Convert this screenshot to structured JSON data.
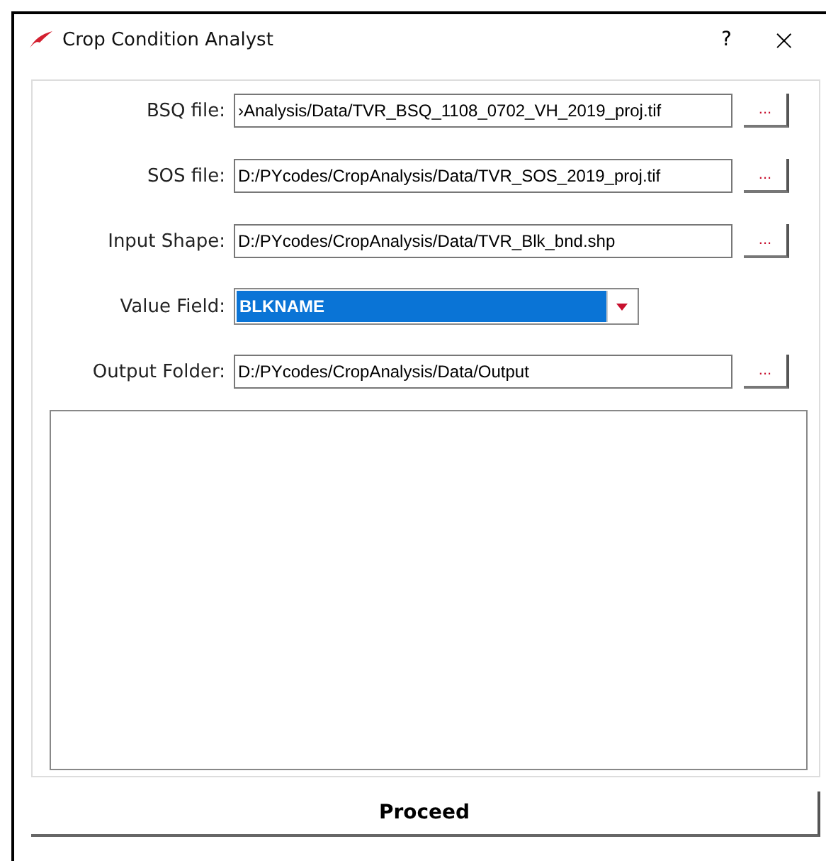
{
  "window": {
    "title": "Crop Condition Analyst",
    "help": "?",
    "close": "×"
  },
  "rows": [
    {
      "kind": "file",
      "label": "BSQ file:",
      "value": "›Analysis/Data/TVR_BSQ_1108_0702_VH_2019_proj.tif",
      "button": "..."
    },
    {
      "kind": "file",
      "label": "SOS file:",
      "value": "D:/PYcodes/CropAnalysis/Data/TVR_SOS_2019_proj.tif",
      "button": "..."
    },
    {
      "kind": "file",
      "label": "Input Shape:",
      "value": "D:/PYcodes/CropAnalysis/Data/TVR_Blk_bnd.shp",
      "button": "..."
    },
    {
      "kind": "combo",
      "label": "Value Field:",
      "value": "BLKNAME",
      "highlighted": true
    },
    {
      "kind": "file",
      "label": "Output Folder:",
      "value": "D:/PYcodes/CropAnalysis/Data/Output",
      "button": "..."
    }
  ],
  "proceed": "Proceed"
}
